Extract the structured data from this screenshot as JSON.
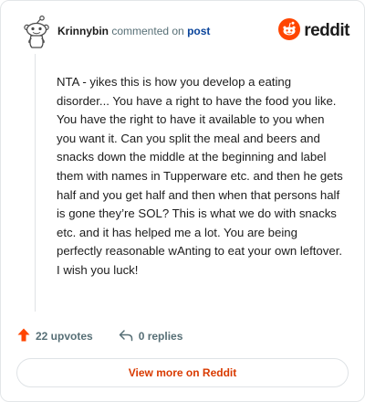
{
  "header": {
    "author": "Krinnybin",
    "action": "commented on",
    "post_link": "post",
    "brand": "reddit"
  },
  "comment": {
    "text": "NTA - yikes this is how you develop a eating disorder... You have a right to have the food you like. You have the right to have it available to you when you want it. Can you split the meal and beers and snacks down the middle at the beginning and label them with names in Tupperware etc. and then he gets half and you get half and then when that persons half is gone they’re SOL? This is what we do with snacks etc. and it has helped me a lot. You are being perfectly reasonable wAnting to eat your own leftover. I wish you luck!"
  },
  "footer": {
    "upvotes": "22 upvotes",
    "replies": "0 replies"
  },
  "cta": {
    "label": "View more on Reddit"
  },
  "colors": {
    "reddit_orange": "#ff4500",
    "link_blue": "#0a449b",
    "cta_text": "#d93a00"
  }
}
